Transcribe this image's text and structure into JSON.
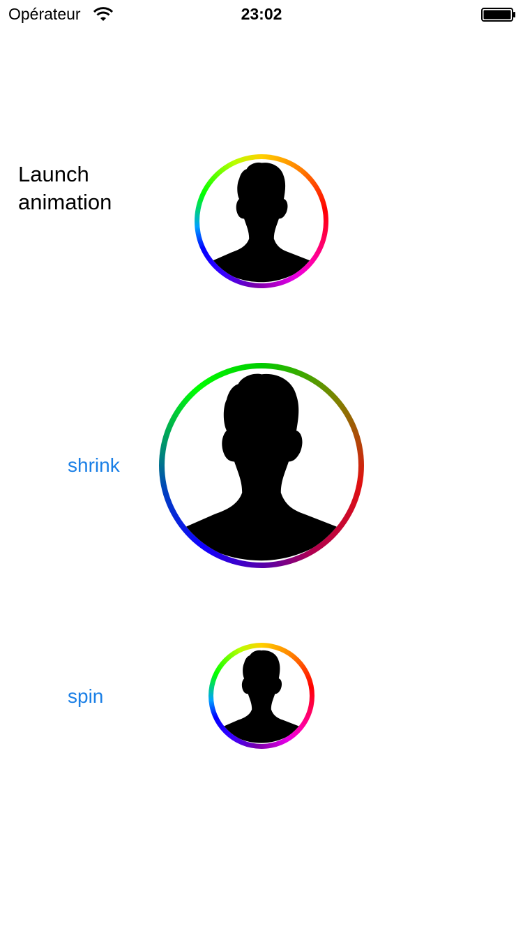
{
  "status_bar": {
    "carrier": "Opérateur",
    "time": "23:02",
    "wifi_icon": "wifi-icon",
    "battery_icon": "battery-icon"
  },
  "content": {
    "title_line1": "Launch",
    "title_line2": "animation",
    "shrink_label": "shrink",
    "spin_label": "spin",
    "link_color": "#1a7fe6",
    "avatar_icon": "person-silhouette-icon"
  }
}
